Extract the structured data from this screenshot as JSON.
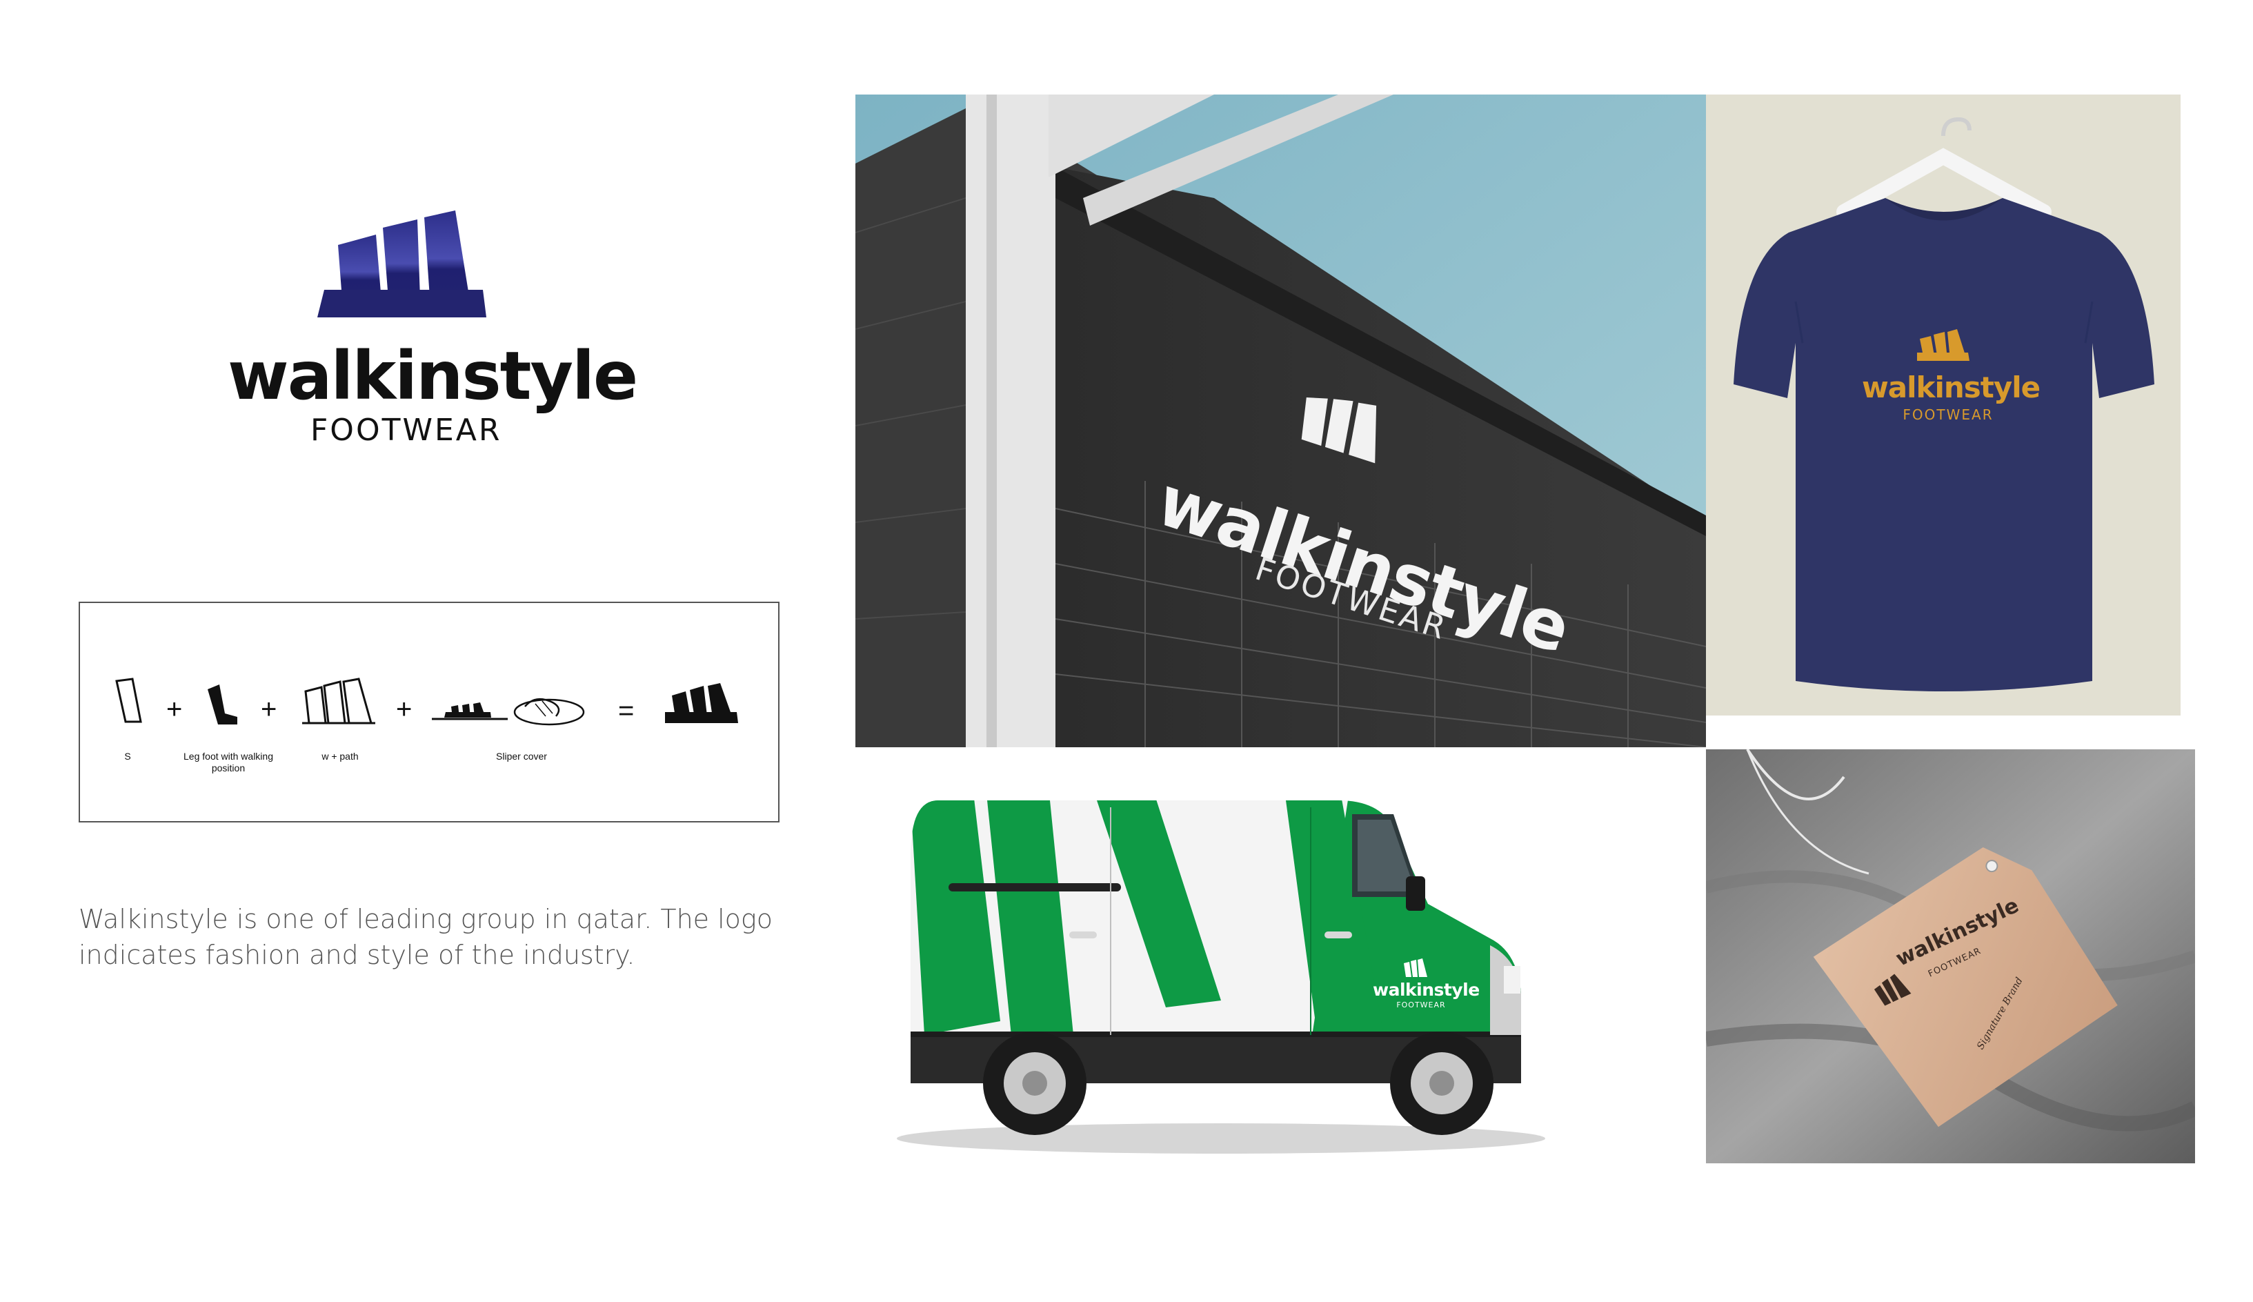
{
  "brand": {
    "name": "walkinstyle",
    "tagline": "FOOTWEAR",
    "primary_color": "#2a2b7a",
    "tshirt_color": "#2f3566",
    "tshirt_logo_color": "#d89a2c",
    "van_green": "#0e9a45",
    "tag_color": "#d9b296"
  },
  "concept": {
    "steps": [
      {
        "label": "S"
      },
      {
        "label": "Leg foot with walking position"
      },
      {
        "label": "w +  path"
      },
      {
        "label": "Sliper cover"
      }
    ],
    "operators": [
      "+",
      "+",
      "+",
      "="
    ]
  },
  "description": "Walkinstyle is one of leading group in qatar. The logo indicates fashion and style of the industry.",
  "tag_text": {
    "line1": "Signature Brand"
  }
}
